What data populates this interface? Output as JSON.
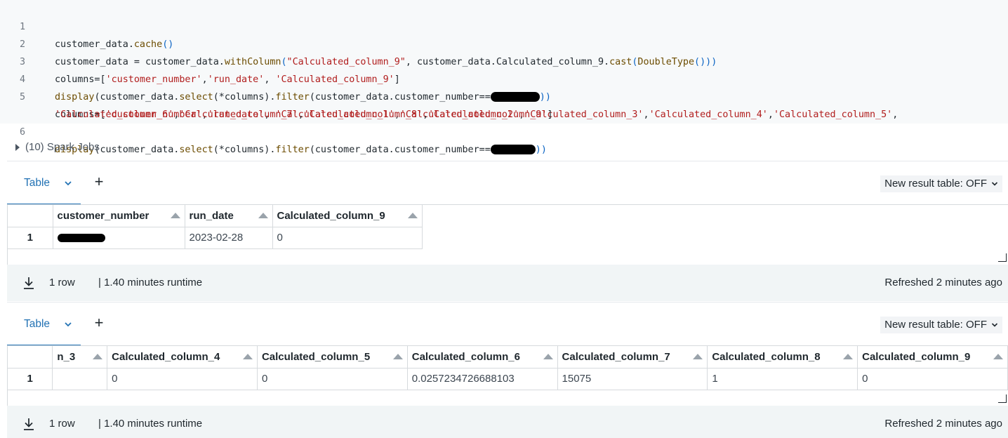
{
  "code": {
    "line_numbers": [
      "1",
      "2",
      "3",
      "4",
      "5",
      "6"
    ],
    "line1": {
      "a": "customer_data",
      "b": ".",
      "c": "cache",
      "d": "()"
    },
    "line2": {
      "a": "customer_data = customer_data.",
      "b": "withColumn",
      "c": "(",
      "d": "\"Calculated_column_9\"",
      "e": ", customer_data.Calculated_column_9.",
      "f": "cast",
      "g": "(",
      "h": "DoubleType",
      "i": "()",
      "j": "))"
    },
    "line3": {
      "a": "columns=[",
      "b": "'customer_number'",
      "c": ",",
      "d": "'run_date'",
      "e": ", ",
      "f": "'Calculated_column_9'",
      "g": "]"
    },
    "line4": {
      "a": "display",
      "b": "(customer_data.",
      "c": "select",
      "d": "(*columns).",
      "e": "filter",
      "f": "(customer_data.customer_number==",
      "g": "))"
    },
    "line5a": {
      "a": "columns=[",
      "b": "'customer_number'",
      "c": ",",
      "d": "'run_date'",
      "e": ", ",
      "f": "'Calculated_column_1'",
      "g": ",",
      "h": "'Calculated_column_2'",
      "i": ",",
      "j": "'Calculated_column_3'",
      "k": ",",
      "l": "'Calculated_column_4'",
      "m": ",",
      "n": "'Calculated_column_5'",
      "o": ","
    },
    "line5b": {
      "a": "'Calculated_column_6'",
      "b": ",",
      "c": "'Calculated_column_7'",
      "d": ",",
      "e": "'Calculated_column_8'",
      "f": ",",
      "g": "'Calculated_column_9'",
      "h": "]"
    },
    "line6": {
      "a": "display",
      "b": "(customer_data.",
      "c": "select",
      "d": "(*columns).",
      "e": "filter",
      "f": "(customer_data.customer_number==",
      "g": "))"
    }
  },
  "spark_jobs": {
    "label": "(10) Spark Jobs",
    "icon": "caret-right-icon"
  },
  "results": [
    {
      "tab_label": "Table",
      "new_result_label": "New result table: OFF",
      "columns": [
        "customer_number",
        "run_date",
        "Calculated_column_9"
      ],
      "row": {
        "number": "1",
        "customer_number": "",
        "run_date": "2023-02-28",
        "calculated_column_9": "0"
      },
      "footer": {
        "rows": "1 row",
        "runtime": "| 1.40 minutes runtime",
        "refreshed": "Refreshed 2 minutes ago"
      }
    },
    {
      "tab_label": "Table",
      "new_result_label": "New result table: OFF",
      "columns": [
        "n_3",
        "Calculated_column_4",
        "Calculated_column_5",
        "Calculated_column_6",
        "Calculated_column_7",
        "Calculated_column_8",
        "Calculated_column_9"
      ],
      "row": {
        "number": "1",
        "values": [
          "",
          "0",
          "0",
          "0.0257234726688103",
          "15075",
          "1",
          "0"
        ]
      },
      "footer": {
        "rows": "1 row",
        "runtime": "| 1.40 minutes runtime",
        "refreshed": "Refreshed 2 minutes ago"
      }
    }
  ],
  "colors": {
    "accent": "#2272b4",
    "string": "#b11d1d",
    "method": "#6c4c00",
    "footer_bg": "#f1f5f6",
    "editor_bg": "#f7f9fa"
  }
}
